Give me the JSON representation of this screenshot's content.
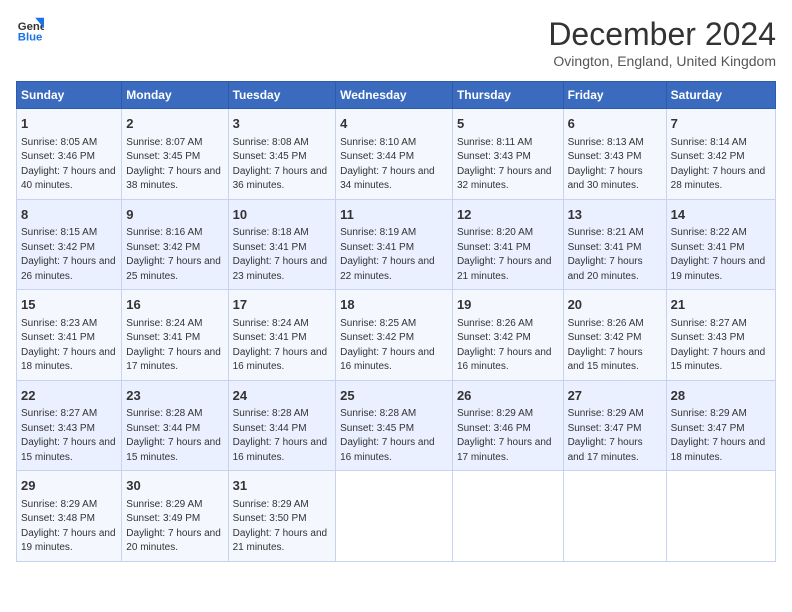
{
  "header": {
    "month_year": "December 2024",
    "location": "Ovington, England, United Kingdom",
    "logo_line1": "General",
    "logo_line2": "Blue"
  },
  "weekdays": [
    "Sunday",
    "Monday",
    "Tuesday",
    "Wednesday",
    "Thursday",
    "Friday",
    "Saturday"
  ],
  "weeks": [
    [
      {
        "day": "1",
        "sunrise": "Sunrise: 8:05 AM",
        "sunset": "Sunset: 3:46 PM",
        "daylight": "Daylight: 7 hours and 40 minutes."
      },
      {
        "day": "2",
        "sunrise": "Sunrise: 8:07 AM",
        "sunset": "Sunset: 3:45 PM",
        "daylight": "Daylight: 7 hours and 38 minutes."
      },
      {
        "day": "3",
        "sunrise": "Sunrise: 8:08 AM",
        "sunset": "Sunset: 3:45 PM",
        "daylight": "Daylight: 7 hours and 36 minutes."
      },
      {
        "day": "4",
        "sunrise": "Sunrise: 8:10 AM",
        "sunset": "Sunset: 3:44 PM",
        "daylight": "Daylight: 7 hours and 34 minutes."
      },
      {
        "day": "5",
        "sunrise": "Sunrise: 8:11 AM",
        "sunset": "Sunset: 3:43 PM",
        "daylight": "Daylight: 7 hours and 32 minutes."
      },
      {
        "day": "6",
        "sunrise": "Sunrise: 8:13 AM",
        "sunset": "Sunset: 3:43 PM",
        "daylight": "Daylight: 7 hours and 30 minutes."
      },
      {
        "day": "7",
        "sunrise": "Sunrise: 8:14 AM",
        "sunset": "Sunset: 3:42 PM",
        "daylight": "Daylight: 7 hours and 28 minutes."
      }
    ],
    [
      {
        "day": "8",
        "sunrise": "Sunrise: 8:15 AM",
        "sunset": "Sunset: 3:42 PM",
        "daylight": "Daylight: 7 hours and 26 minutes."
      },
      {
        "day": "9",
        "sunrise": "Sunrise: 8:16 AM",
        "sunset": "Sunset: 3:42 PM",
        "daylight": "Daylight: 7 hours and 25 minutes."
      },
      {
        "day": "10",
        "sunrise": "Sunrise: 8:18 AM",
        "sunset": "Sunset: 3:41 PM",
        "daylight": "Daylight: 7 hours and 23 minutes."
      },
      {
        "day": "11",
        "sunrise": "Sunrise: 8:19 AM",
        "sunset": "Sunset: 3:41 PM",
        "daylight": "Daylight: 7 hours and 22 minutes."
      },
      {
        "day": "12",
        "sunrise": "Sunrise: 8:20 AM",
        "sunset": "Sunset: 3:41 PM",
        "daylight": "Daylight: 7 hours and 21 minutes."
      },
      {
        "day": "13",
        "sunrise": "Sunrise: 8:21 AM",
        "sunset": "Sunset: 3:41 PM",
        "daylight": "Daylight: 7 hours and 20 minutes."
      },
      {
        "day": "14",
        "sunrise": "Sunrise: 8:22 AM",
        "sunset": "Sunset: 3:41 PM",
        "daylight": "Daylight: 7 hours and 19 minutes."
      }
    ],
    [
      {
        "day": "15",
        "sunrise": "Sunrise: 8:23 AM",
        "sunset": "Sunset: 3:41 PM",
        "daylight": "Daylight: 7 hours and 18 minutes."
      },
      {
        "day": "16",
        "sunrise": "Sunrise: 8:24 AM",
        "sunset": "Sunset: 3:41 PM",
        "daylight": "Daylight: 7 hours and 17 minutes."
      },
      {
        "day": "17",
        "sunrise": "Sunrise: 8:24 AM",
        "sunset": "Sunset: 3:41 PM",
        "daylight": "Daylight: 7 hours and 16 minutes."
      },
      {
        "day": "18",
        "sunrise": "Sunrise: 8:25 AM",
        "sunset": "Sunset: 3:42 PM",
        "daylight": "Daylight: 7 hours and 16 minutes."
      },
      {
        "day": "19",
        "sunrise": "Sunrise: 8:26 AM",
        "sunset": "Sunset: 3:42 PM",
        "daylight": "Daylight: 7 hours and 16 minutes."
      },
      {
        "day": "20",
        "sunrise": "Sunrise: 8:26 AM",
        "sunset": "Sunset: 3:42 PM",
        "daylight": "Daylight: 7 hours and 15 minutes."
      },
      {
        "day": "21",
        "sunrise": "Sunrise: 8:27 AM",
        "sunset": "Sunset: 3:43 PM",
        "daylight": "Daylight: 7 hours and 15 minutes."
      }
    ],
    [
      {
        "day": "22",
        "sunrise": "Sunrise: 8:27 AM",
        "sunset": "Sunset: 3:43 PM",
        "daylight": "Daylight: 7 hours and 15 minutes."
      },
      {
        "day": "23",
        "sunrise": "Sunrise: 8:28 AM",
        "sunset": "Sunset: 3:44 PM",
        "daylight": "Daylight: 7 hours and 15 minutes."
      },
      {
        "day": "24",
        "sunrise": "Sunrise: 8:28 AM",
        "sunset": "Sunset: 3:44 PM",
        "daylight": "Daylight: 7 hours and 16 minutes."
      },
      {
        "day": "25",
        "sunrise": "Sunrise: 8:28 AM",
        "sunset": "Sunset: 3:45 PM",
        "daylight": "Daylight: 7 hours and 16 minutes."
      },
      {
        "day": "26",
        "sunrise": "Sunrise: 8:29 AM",
        "sunset": "Sunset: 3:46 PM",
        "daylight": "Daylight: 7 hours and 17 minutes."
      },
      {
        "day": "27",
        "sunrise": "Sunrise: 8:29 AM",
        "sunset": "Sunset: 3:47 PM",
        "daylight": "Daylight: 7 hours and 17 minutes."
      },
      {
        "day": "28",
        "sunrise": "Sunrise: 8:29 AM",
        "sunset": "Sunset: 3:47 PM",
        "daylight": "Daylight: 7 hours and 18 minutes."
      }
    ],
    [
      {
        "day": "29",
        "sunrise": "Sunrise: 8:29 AM",
        "sunset": "Sunset: 3:48 PM",
        "daylight": "Daylight: 7 hours and 19 minutes."
      },
      {
        "day": "30",
        "sunrise": "Sunrise: 8:29 AM",
        "sunset": "Sunset: 3:49 PM",
        "daylight": "Daylight: 7 hours and 20 minutes."
      },
      {
        "day": "31",
        "sunrise": "Sunrise: 8:29 AM",
        "sunset": "Sunset: 3:50 PM",
        "daylight": "Daylight: 7 hours and 21 minutes."
      },
      null,
      null,
      null,
      null
    ]
  ]
}
